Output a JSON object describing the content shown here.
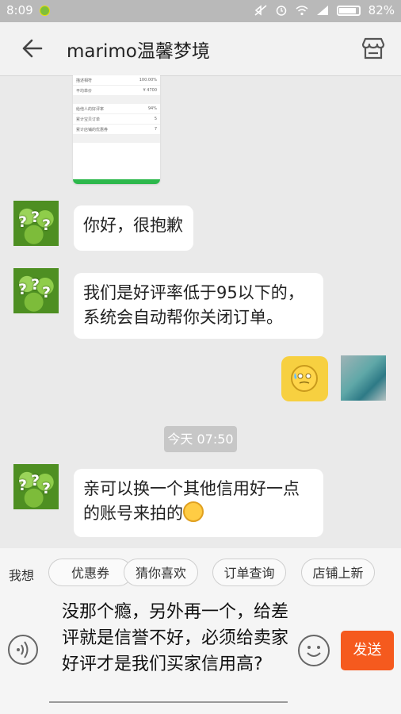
{
  "status_bar": {
    "time": "8:09",
    "battery": "82%",
    "battery_level": 0.82,
    "icons": [
      "app-notification-icon",
      "mute-icon",
      "alarm-icon",
      "wifi-icon",
      "signal-icon",
      "battery-icon"
    ]
  },
  "header": {
    "title": "marimo温馨梦境",
    "back_icon": "arrow-left-icon",
    "store_icon": "store-icon"
  },
  "screenshot_preview": {
    "rows": [
      {
        "label": "描述相符",
        "value": "100.00%"
      },
      {
        "label": "平均单价",
        "value": "¥ 4700"
      },
      {
        "label": "给他人的好评率",
        "value": "94%"
      },
      {
        "label": "累计宝贝订单",
        "value": "5"
      },
      {
        "label": "累计店铺的优惠券",
        "value": "7"
      }
    ]
  },
  "messages": [
    {
      "side": "left",
      "text": "你好，很抱歉"
    },
    {
      "side": "left",
      "text": "我们是好评率低于95以下的，系统会自动帮你关闭订单。"
    },
    {
      "side": "right",
      "type": "emoji"
    },
    {
      "side": "left",
      "text": "亲可以换一个其他信用好一点的账号来拍的"
    }
  ],
  "time_separator": "今天 07:50",
  "quick_bar": {
    "label": "我想",
    "chips": [
      "优惠券",
      "猜你喜欢",
      "订单查询",
      "店铺上新"
    ]
  },
  "input": {
    "value": "没那个瘾，另外再一个，给差评就是信誉不好，必须给卖家好评才是我们买家信用高?"
  },
  "send_label": "发送"
}
